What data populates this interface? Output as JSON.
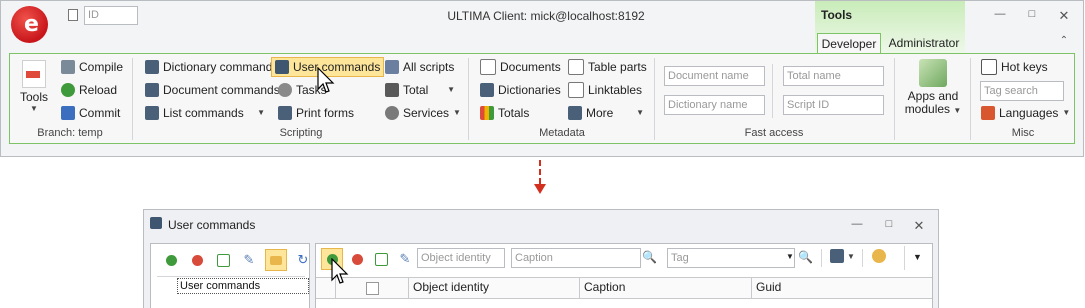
{
  "main_window": {
    "id_placeholder": "ID",
    "title": "ULTIMA Client: mick@localhost:8192",
    "context_tab": "Tools",
    "tabs": [
      {
        "label": "Developer",
        "active": true
      },
      {
        "label": "Administrator",
        "active": false
      }
    ]
  },
  "ribbon": {
    "branch": {
      "tools_label": "Tools",
      "compile": "Compile",
      "reload": "Reload",
      "commit": "Commit",
      "group_label": "Branch: temp"
    },
    "scripting": {
      "dictionary_commands": "Dictionary commands",
      "document_commands": "Document commands",
      "list_commands": "List commands",
      "user_commands": "User commands",
      "tasks": "Tasks",
      "print_forms": "Print forms",
      "all_scripts": "All scripts",
      "total": "Total",
      "services": "Services",
      "group_label": "Scripting"
    },
    "metadata": {
      "documents": "Documents",
      "dictionaries": "Dictionaries",
      "totals": "Totals",
      "table_parts": "Table parts",
      "linktables": "Linktables",
      "more": "More",
      "group_label": "Metadata"
    },
    "fast_access": {
      "document_name_placeholder": "Document name",
      "dictionary_name_placeholder": "Dictionary name",
      "total_name_placeholder": "Total name",
      "script_id_placeholder": "Script ID",
      "group_label": "Fast access"
    },
    "apps": {
      "line1": "Apps and",
      "line2": "modules"
    },
    "misc": {
      "hot_keys": "Hot keys",
      "tag_search_placeholder": "Tag search",
      "languages": "Languages",
      "group_label": "Misc"
    }
  },
  "child_window": {
    "title": "User commands",
    "tree_item": "User commands",
    "object_identity_placeholder": "Object identity",
    "caption_placeholder": "Caption",
    "tag_placeholder": "Tag",
    "columns": [
      "Object identity",
      "Caption",
      "Guid"
    ]
  },
  "colors": {
    "accent_green": "#7cc466",
    "highlight": "#fde59a",
    "arrow_red": "#d32f1e"
  }
}
